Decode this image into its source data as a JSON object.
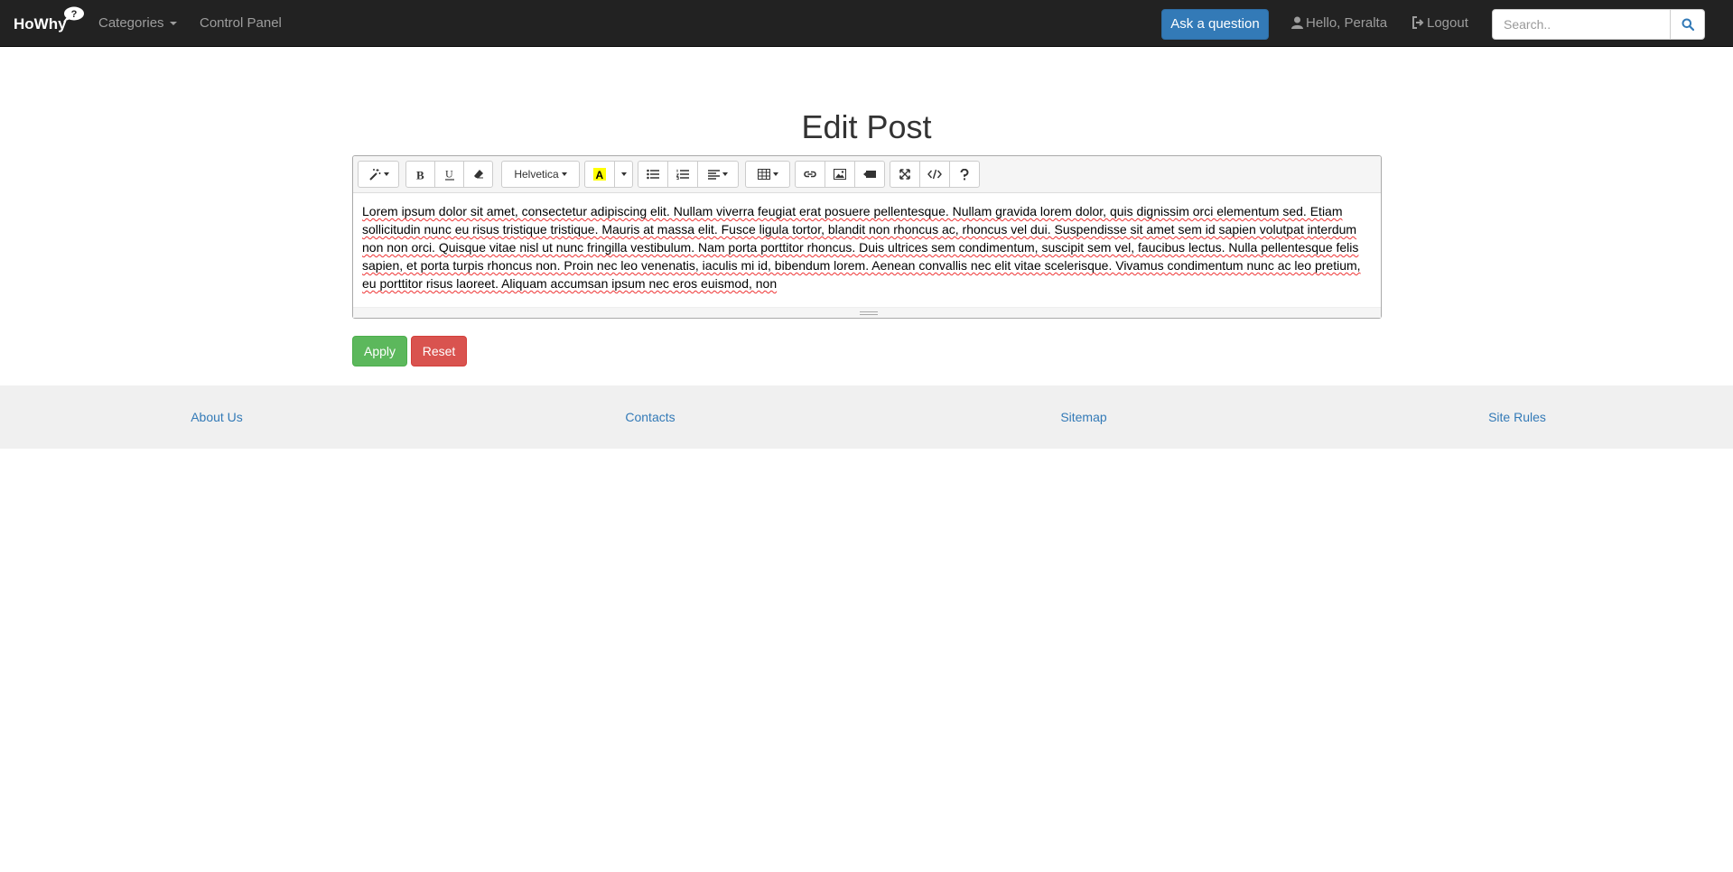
{
  "navbar": {
    "brand": "HoWhy",
    "brand_bubble_glyph": "?",
    "categories": "Categories",
    "control_panel": "Control Panel",
    "ask": "Ask a question",
    "hello": "Hello, Peralta",
    "logout": "Logout",
    "search_placeholder": "Search.."
  },
  "page": {
    "title": "Edit Post"
  },
  "editor": {
    "font_name": "Helvetica",
    "toolbar_icons": [
      "magic-icon",
      "bold-icon",
      "underline-icon",
      "eraser-icon",
      "font-name-dropdown",
      "text-color-icon",
      "color-caret-icon",
      "unordered-list-icon",
      "ordered-list-icon",
      "align-icon",
      "table-icon",
      "link-icon",
      "picture-icon",
      "video-icon",
      "fullscreen-icon",
      "code-view-icon",
      "help-icon"
    ],
    "content": "Lorem ipsum dolor sit amet, consectetur adipiscing elit. Nullam viverra feugiat erat posuere pellentesque. Nullam gravida lorem dolor, quis dignissim orci elementum sed. Etiam sollicitudin nunc eu risus tristique tristique. Mauris at massa elit. Fusce ligula tortor, blandit non rhoncus ac, rhoncus vel dui. Suspendisse sit amet sem id sapien volutpat interdum non non orci. Quisque vitae nisl ut nunc fringilla vestibulum. Nam porta porttitor rhoncus. Duis ultrices sem condimentum, suscipit sem vel, faucibus lectus. Nulla pellentesque felis sapien, et porta turpis rhoncus non. Proin nec leo venenatis, iaculis mi id, bibendum lorem. Aenean convallis nec elit vitae scelerisque. Vivamus condimentum nunc ac leo pretium, eu porttitor risus laoreet. Aliquam accumsan ipsum nec eros euismod, non"
  },
  "form": {
    "apply": "Apply",
    "reset": "Reset"
  },
  "footer": {
    "links": [
      "About Us",
      "Contacts",
      "Sitemap",
      "Site Rules"
    ]
  },
  "colors": {
    "navbar_bg": "#222222",
    "primary": "#337ab7",
    "success": "#5cb85c",
    "danger": "#d9534f",
    "footer_bg": "#f0f0f0"
  }
}
